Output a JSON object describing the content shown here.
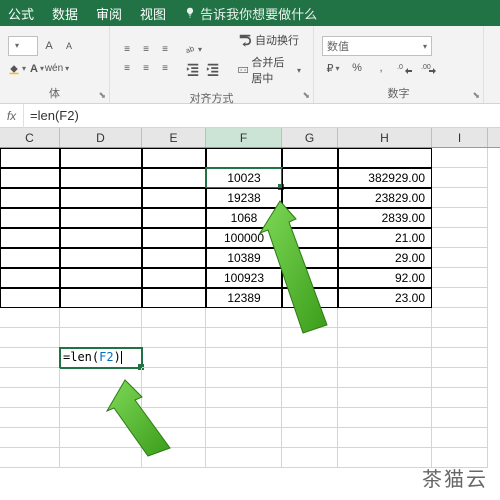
{
  "tabs": {
    "formula": "公式",
    "data": "数据",
    "review": "审阅",
    "view": "视图",
    "tellme": "告诉我你想要做什么"
  },
  "ribbon": {
    "font": {
      "label": "体",
      "sizeA": "A",
      "sizeB": "A"
    },
    "align": {
      "label": "对齐方式",
      "wrap": "自动换行",
      "merge": "合并后居中"
    },
    "number": {
      "label": "数字",
      "format": "数值",
      "currency": "₽",
      "percent": "%",
      "comma": ",",
      "inc": ".0",
      "dec": ".00"
    }
  },
  "formula_bar": {
    "fx": "fx",
    "value": "=len(F2)"
  },
  "columns": [
    "C",
    "D",
    "E",
    "F",
    "G",
    "H",
    "I"
  ],
  "selected_col": "F",
  "editing": {
    "text_prefix": "=len(",
    "ref": "F2",
    "text_suffix": ")"
  },
  "rows": [
    {
      "F": "10023",
      "H": "382929.00"
    },
    {
      "F": "19238",
      "H": "23829.00"
    },
    {
      "F": "1068",
      "H": "2839.00"
    },
    {
      "F": "100000",
      "H": "21.00"
    },
    {
      "F": "10389",
      "H": "29.00"
    },
    {
      "F": "100923",
      "H": "92.00"
    },
    {
      "F": "12389",
      "H": "23.00"
    }
  ],
  "watermark": "茶猫云",
  "chart_data": null
}
